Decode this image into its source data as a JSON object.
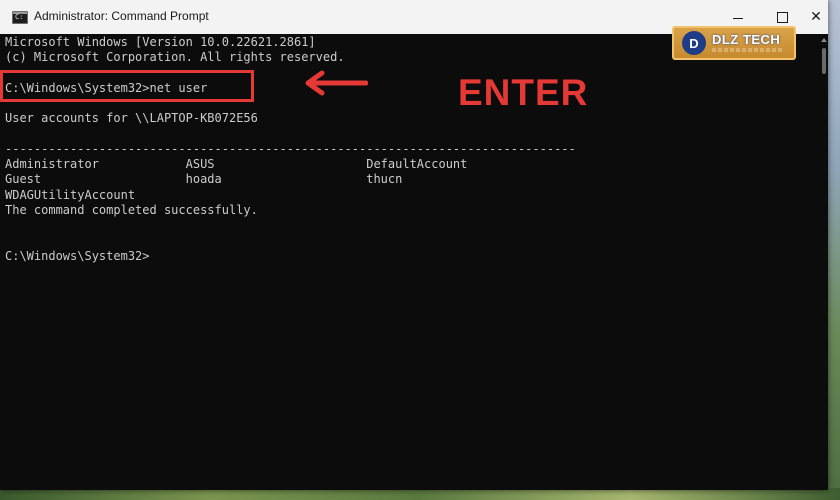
{
  "window": {
    "title": "Administrator: Command Prompt",
    "controls": [
      "minimize",
      "maximize",
      "close"
    ]
  },
  "console": {
    "lines": [
      "Microsoft Windows [Version 10.0.22621.2861]",
      "(c) Microsoft Corporation. All rights reserved.",
      "",
      "C:\\Windows\\System32>net user",
      "",
      "User accounts for \\\\LAPTOP-KB072E56",
      "",
      "-------------------------------------------------------------------------------",
      "Administrator            ASUS                     DefaultAccount",
      "Guest                    hoada                    thucn",
      "WDAGUtilityAccount",
      "The command completed successfully.",
      "",
      "",
      "C:\\Windows\\System32>"
    ]
  },
  "annotation": {
    "label": "ENTER",
    "color": "#e53935"
  },
  "logo": {
    "mark": "D",
    "text": "DLZ TECH"
  },
  "icons": {
    "app": "cmd-icon",
    "arrow": "arrow-left-icon"
  }
}
